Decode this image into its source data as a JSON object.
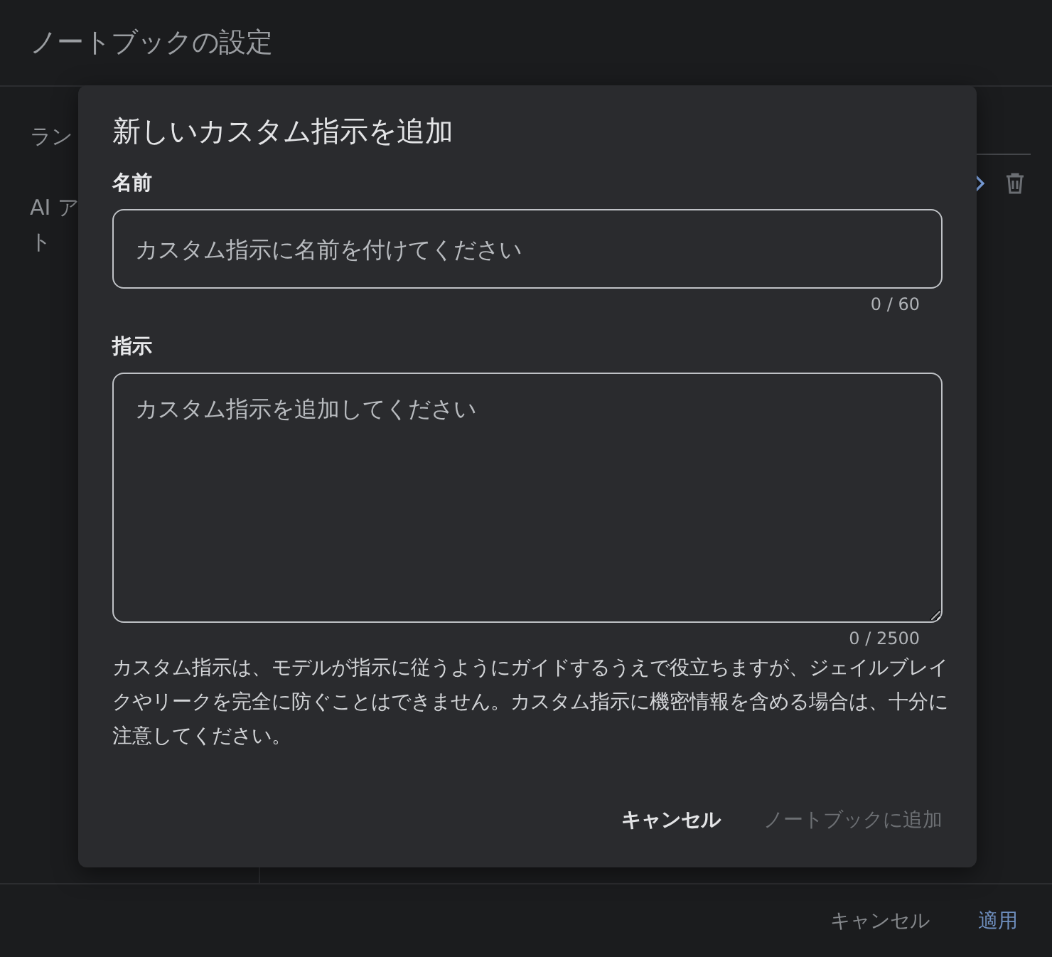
{
  "page": {
    "title": "ノートブックの設定"
  },
  "sidebar": {
    "items": [
      {
        "lines": [
          "ラン"
        ]
      },
      {
        "lines": [
          "AI ア",
          "ト"
        ]
      }
    ]
  },
  "footer": {
    "buttons": [
      {
        "label": "キャンセル",
        "kind": "text"
      },
      {
        "label": "適用",
        "kind": "primary"
      }
    ]
  },
  "dialog": {
    "title": "新しいカスタム指示を追加",
    "fields": [
      {
        "label": "名前",
        "kind": "input",
        "placeholder": "カスタム指示に名前を付けてください",
        "counter": "0 / 60"
      },
      {
        "label": "指示",
        "kind": "textarea",
        "placeholder": "カスタム指示を追加してください",
        "counter": "0 / 2500"
      }
    ],
    "note": "カスタム指示は、モデルが指示に従うようにガイドするうえで役立ちますが、ジェイルブレイクやリークを完全に防ぐことはできません。カスタム指示に機密情報を含める場合は、十分に注意してください。",
    "buttons": [
      {
        "label": "キャンセル",
        "disabled": false
      },
      {
        "label": "ノートブックに追加",
        "disabled": true
      }
    ]
  }
}
